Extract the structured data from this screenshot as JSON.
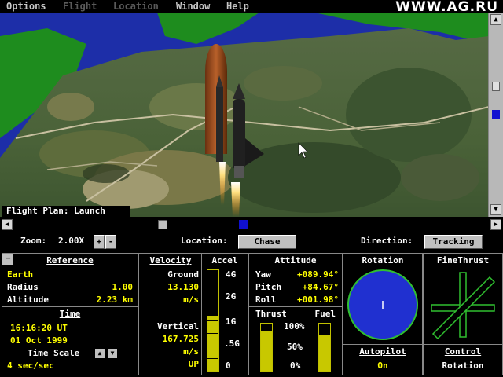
{
  "menu": [
    "Options",
    "Flight",
    "Location",
    "Window",
    "Help"
  ],
  "watermark": "WWW.AG.RU",
  "viewport": {
    "caption": "Flight Plan: Launch"
  },
  "toolbar": {
    "zoom_label": "Zoom:",
    "zoom_value": "2.00X",
    "zoom_plus": "+",
    "zoom_minus": "-",
    "location_label": "Location:",
    "location_value": "Chase",
    "direction_label": "Direction:",
    "direction_value": "Tracking"
  },
  "reference": {
    "title": "Reference",
    "body": "Earth",
    "radius_label": "Radius",
    "radius_value": "1.00",
    "altitude_label": "Altitude",
    "altitude_value": "2.23 km"
  },
  "time": {
    "title": "Time",
    "clock": "16:16:20 UT",
    "date": "01 Oct 1999",
    "scale_label": "Time Scale",
    "scale_value": "4 sec/sec"
  },
  "velocity": {
    "title": "Velocity",
    "ground_label": "Ground",
    "ground_value": "13.130",
    "ground_unit": "m/s",
    "vertical_label": "Vertical",
    "vertical_value": "167.725",
    "vertical_unit": "m/s",
    "vertical_dir": "UP"
  },
  "accel": {
    "title": "Accel",
    "ticks": [
      "4G",
      "2G",
      "1G",
      ".5G",
      "0"
    ],
    "level": 0.55
  },
  "attitude": {
    "title": "Attitude",
    "yaw_label": "Yaw",
    "yaw_value": "+089.94°",
    "pitch_label": "Pitch",
    "pitch_value": "+84.67°",
    "roll_label": "Roll",
    "roll_value": "+001.98°"
  },
  "thrust": {
    "title": "Thrust",
    "level": 0.85
  },
  "fuel": {
    "title": "Fuel",
    "level": 0.75
  },
  "throttle_ticks": [
    "100%",
    "50%",
    "0%"
  ],
  "rotation": {
    "title": "Rotation"
  },
  "finethrust": {
    "title": "FineThrust"
  },
  "autopilot": {
    "title": "Autopilot",
    "value": "On"
  },
  "control": {
    "title": "Control",
    "value": "Rotation"
  },
  "colors": {
    "panel_yellow": "#ffff00",
    "gauge_fill": "#c8c800",
    "rotation_blue": "#2030d0",
    "rotation_ring": "#30c030",
    "water_green": "#1e8c1e",
    "water_blue": "#1d2ea8"
  }
}
